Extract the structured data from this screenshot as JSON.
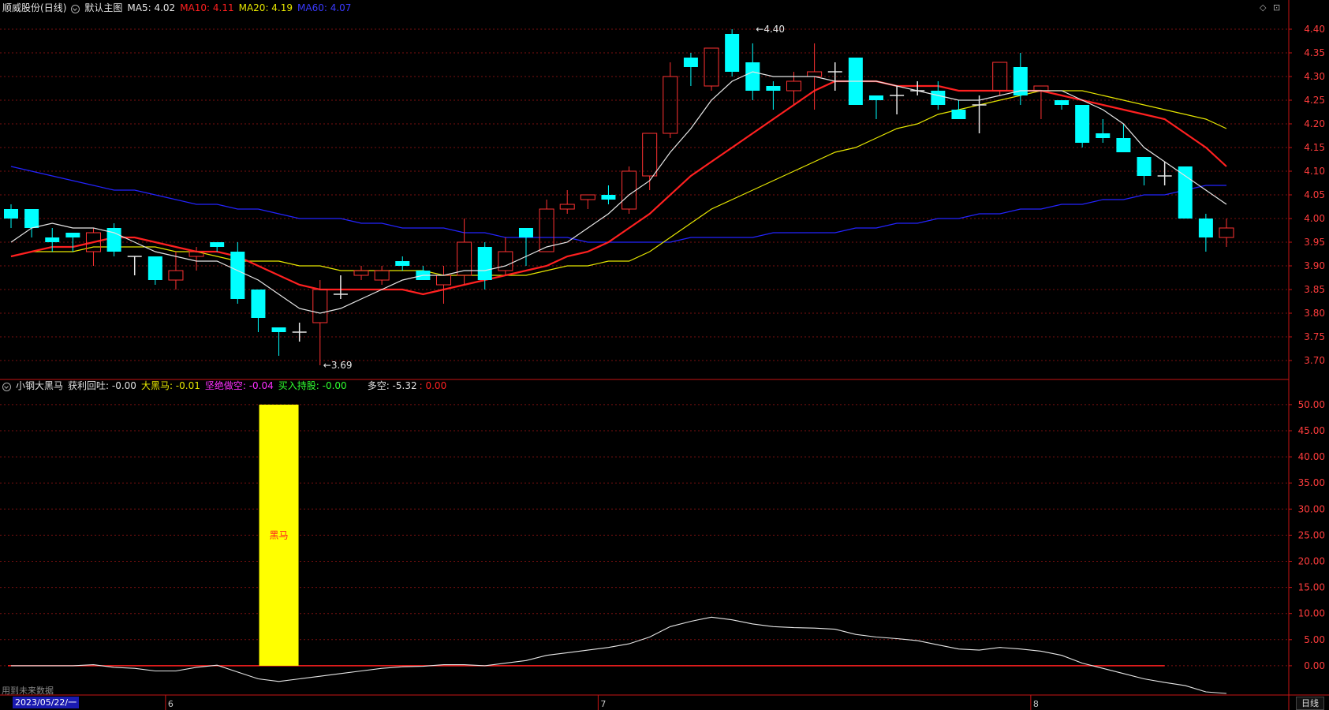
{
  "header": {
    "stock_name": "顺威股份",
    "period": "(日线)",
    "main_chart_label": "默认主图",
    "ma5": "MA5: 4.02",
    "ma10": "MA10: 4.11",
    "ma20": "MA20: 4.19",
    "ma60": "MA60: 4.07"
  },
  "indicator_header": {
    "name": "小钢大黑马",
    "f1": "获利回吐: -0.00",
    "f2": "大黑马: -0.01",
    "f3": "坚绝做空: -0.04",
    "f4": "买入持股: -0.00",
    "f5": "多空: -5.32",
    "f6": ": 0.00"
  },
  "colors": {
    "up": "#ff3232",
    "down": "#00ffff",
    "ma5": "#e6e6e6",
    "ma10": "#ff2020",
    "ma20": "#e6e600",
    "ma60": "#2323ff",
    "grid": "#7a1010",
    "axis": "#c81414",
    "bar": "#ffff00"
  },
  "footer": {
    "date": "2023/05/22/一",
    "note": "用到未来数据",
    "period_tab": "日线"
  },
  "chart_data": [
    {
      "type": "candlestick",
      "y_ticks": [
        "4.40",
        "4.35",
        "4.30",
        "4.25",
        "4.20",
        "4.15",
        "4.10",
        "4.05",
        "4.00",
        "3.95",
        "3.90",
        "3.85",
        "3.80",
        "3.75",
        "3.70"
      ],
      "ylim": [
        3.665,
        4.425
      ],
      "x_month_labels": [
        {
          "i": 8,
          "label": "6"
        },
        {
          "i": 29,
          "label": "7"
        },
        {
          "i": 50,
          "label": "8"
        }
      ],
      "annotations": [
        {
          "i": 36,
          "price": 4.4,
          "label": "4.40",
          "kind": "high"
        },
        {
          "i": 15,
          "price": 3.69,
          "label": "3.69",
          "kind": "low"
        }
      ],
      "candles": [
        [
          4.02,
          4.03,
          3.98,
          4.0
        ],
        [
          4.02,
          4.02,
          3.96,
          3.98
        ],
        [
          3.96,
          3.98,
          3.93,
          3.95
        ],
        [
          3.97,
          3.97,
          3.93,
          3.96
        ],
        [
          3.93,
          3.98,
          3.9,
          3.97
        ],
        [
          3.98,
          3.99,
          3.92,
          3.93
        ],
        [
          3.92,
          3.92,
          3.88,
          3.92
        ],
        [
          3.92,
          3.92,
          3.86,
          3.87
        ],
        [
          3.87,
          3.93,
          3.85,
          3.89
        ],
        [
          3.92,
          3.94,
          3.89,
          3.93
        ],
        [
          3.95,
          3.95,
          3.93,
          3.94
        ],
        [
          3.93,
          3.95,
          3.82,
          3.83
        ],
        [
          3.85,
          3.85,
          3.76,
          3.79
        ],
        [
          3.77,
          3.77,
          3.71,
          3.76
        ],
        [
          3.76,
          3.78,
          3.74,
          3.76
        ],
        [
          3.78,
          3.87,
          3.69,
          3.85
        ],
        [
          3.84,
          3.88,
          3.83,
          3.84
        ],
        [
          3.88,
          3.9,
          3.87,
          3.89
        ],
        [
          3.87,
          3.9,
          3.86,
          3.89
        ],
        [
          3.91,
          3.92,
          3.89,
          3.9
        ],
        [
          3.89,
          3.9,
          3.87,
          3.87
        ],
        [
          3.86,
          3.9,
          3.82,
          3.88
        ],
        [
          3.88,
          4.0,
          3.86,
          3.95
        ],
        [
          3.94,
          3.95,
          3.85,
          3.87
        ],
        [
          3.89,
          3.96,
          3.88,
          3.93
        ],
        [
          3.98,
          3.98,
          3.9,
          3.96
        ],
        [
          3.93,
          4.04,
          3.93,
          4.02
        ],
        [
          4.02,
          4.06,
          4.01,
          4.03
        ],
        [
          4.04,
          4.05,
          4.02,
          4.05
        ],
        [
          4.05,
          4.07,
          4.03,
          4.04
        ],
        [
          4.02,
          4.11,
          4.01,
          4.1
        ],
        [
          4.09,
          4.18,
          4.06,
          4.18
        ],
        [
          4.18,
          4.33,
          4.17,
          4.3
        ],
        [
          4.34,
          4.35,
          4.28,
          4.32
        ],
        [
          4.28,
          4.36,
          4.27,
          4.36
        ],
        [
          4.39,
          4.4,
          4.3,
          4.31
        ],
        [
          4.33,
          4.37,
          4.25,
          4.27
        ],
        [
          4.28,
          4.29,
          4.23,
          4.27
        ],
        [
          4.27,
          4.31,
          4.24,
          4.29
        ],
        [
          4.3,
          4.37,
          4.23,
          4.31
        ],
        [
          4.31,
          4.33,
          4.27,
          4.31
        ],
        [
          4.34,
          4.34,
          4.24,
          4.24
        ],
        [
          4.26,
          4.26,
          4.21,
          4.25
        ],
        [
          4.26,
          4.28,
          4.22,
          4.26
        ],
        [
          4.27,
          4.29,
          4.26,
          4.27
        ],
        [
          4.27,
          4.29,
          4.23,
          4.24
        ],
        [
          4.23,
          4.25,
          4.21,
          4.21
        ],
        [
          4.24,
          4.26,
          4.18,
          4.24
        ],
        [
          4.27,
          4.33,
          4.26,
          4.33
        ],
        [
          4.32,
          4.35,
          4.24,
          4.26
        ],
        [
          4.27,
          4.28,
          4.21,
          4.28
        ],
        [
          4.25,
          4.25,
          4.23,
          4.24
        ],
        [
          4.24,
          4.24,
          4.15,
          4.16
        ],
        [
          4.18,
          4.21,
          4.16,
          4.17
        ],
        [
          4.17,
          4.2,
          4.14,
          4.14
        ],
        [
          4.13,
          4.13,
          4.07,
          4.09
        ],
        [
          4.09,
          4.12,
          4.07,
          4.09
        ],
        [
          4.11,
          4.11,
          4.0,
          4.0
        ],
        [
          4.0,
          4.01,
          3.93,
          3.96
        ],
        [
          3.96,
          4.0,
          3.94,
          3.98
        ]
      ],
      "ma5": [
        3.95,
        3.98,
        3.99,
        3.98,
        3.98,
        3.97,
        3.95,
        3.93,
        3.92,
        3.91,
        3.91,
        3.89,
        3.87,
        3.84,
        3.81,
        3.8,
        3.81,
        3.83,
        3.85,
        3.87,
        3.88,
        3.88,
        3.89,
        3.89,
        3.9,
        3.92,
        3.94,
        3.95,
        3.98,
        4.01,
        4.05,
        4.08,
        4.14,
        4.19,
        4.25,
        4.29,
        4.31,
        4.3,
        4.3,
        4.3,
        4.29,
        4.29,
        4.29,
        4.28,
        4.27,
        4.26,
        4.25,
        4.25,
        4.26,
        4.27,
        4.27,
        4.27,
        4.25,
        4.23,
        4.2,
        4.15,
        4.12,
        4.09,
        4.06,
        4.03
      ],
      "ma10": [
        3.92,
        3.93,
        3.94,
        3.94,
        3.95,
        3.96,
        3.96,
        3.95,
        3.94,
        3.93,
        3.93,
        3.92,
        3.9,
        3.88,
        3.86,
        3.85,
        3.85,
        3.85,
        3.85,
        3.85,
        3.84,
        3.85,
        3.86,
        3.87,
        3.88,
        3.89,
        3.9,
        3.92,
        3.93,
        3.95,
        3.98,
        4.01,
        4.05,
        4.09,
        4.12,
        4.15,
        4.18,
        4.21,
        4.24,
        4.27,
        4.29,
        4.29,
        4.29,
        4.28,
        4.28,
        4.28,
        4.27,
        4.27,
        4.27,
        4.27,
        4.27,
        4.26,
        4.25,
        4.24,
        4.23,
        4.22,
        4.21,
        4.18,
        4.15,
        4.11
      ],
      "ma20": [
        3.92,
        3.93,
        3.93,
        3.93,
        3.94,
        3.94,
        3.94,
        3.94,
        3.93,
        3.93,
        3.92,
        3.91,
        3.91,
        3.91,
        3.9,
        3.9,
        3.89,
        3.89,
        3.89,
        3.89,
        3.89,
        3.88,
        3.88,
        3.88,
        3.88,
        3.88,
        3.89,
        3.9,
        3.9,
        3.91,
        3.91,
        3.93,
        3.96,
        3.99,
        4.02,
        4.04,
        4.06,
        4.08,
        4.1,
        4.12,
        4.14,
        4.15,
        4.17,
        4.19,
        4.2,
        4.22,
        4.23,
        4.24,
        4.25,
        4.26,
        4.27,
        4.27,
        4.27,
        4.26,
        4.25,
        4.24,
        4.23,
        4.22,
        4.21,
        4.19
      ],
      "ma60": [
        4.11,
        4.1,
        4.09,
        4.08,
        4.07,
        4.06,
        4.06,
        4.05,
        4.04,
        4.03,
        4.03,
        4.02,
        4.02,
        4.01,
        4.0,
        4.0,
        4.0,
        3.99,
        3.99,
        3.98,
        3.98,
        3.98,
        3.97,
        3.97,
        3.96,
        3.96,
        3.96,
        3.96,
        3.95,
        3.95,
        3.95,
        3.95,
        3.95,
        3.96,
        3.96,
        3.96,
        3.96,
        3.97,
        3.97,
        3.97,
        3.97,
        3.98,
        3.98,
        3.99,
        3.99,
        4.0,
        4.0,
        4.01,
        4.01,
        4.02,
        4.02,
        4.03,
        4.03,
        4.04,
        4.04,
        4.05,
        4.05,
        4.06,
        4.07,
        4.07
      ]
    },
    {
      "type": "indicator",
      "y_ticks": [
        "50.00",
        "45.00",
        "40.00",
        "35.00",
        "30.00",
        "25.00",
        "20.00",
        "15.00",
        "10.00",
        "5.00",
        "0.00"
      ],
      "ylim": [
        -5.3,
        52.4
      ],
      "bar": {
        "i": 13,
        "value": 50,
        "label": "黑马"
      },
      "zero_line_until": 56,
      "line": [
        0.0,
        0.0,
        0.0,
        0.0,
        0.2,
        -0.3,
        -0.5,
        -1.0,
        -1.0,
        -0.3,
        0.1,
        -1.2,
        -2.5,
        -3.0,
        -2.5,
        -2.0,
        -1.5,
        -1.0,
        -0.5,
        -0.2,
        -0.1,
        0.2,
        0.2,
        0.0,
        0.5,
        1.0,
        2.0,
        2.5,
        3.0,
        3.5,
        4.2,
        5.5,
        7.5,
        8.5,
        9.3,
        8.8,
        8.0,
        7.5,
        7.3,
        7.2,
        7.0,
        6.0,
        5.5,
        5.2,
        4.8,
        4.0,
        3.2,
        3.0,
        3.5,
        3.2,
        2.8,
        2.0,
        0.5,
        -0.5,
        -1.5,
        -2.5,
        -3.2,
        -3.8,
        -5.0,
        -5.3
      ]
    }
  ]
}
